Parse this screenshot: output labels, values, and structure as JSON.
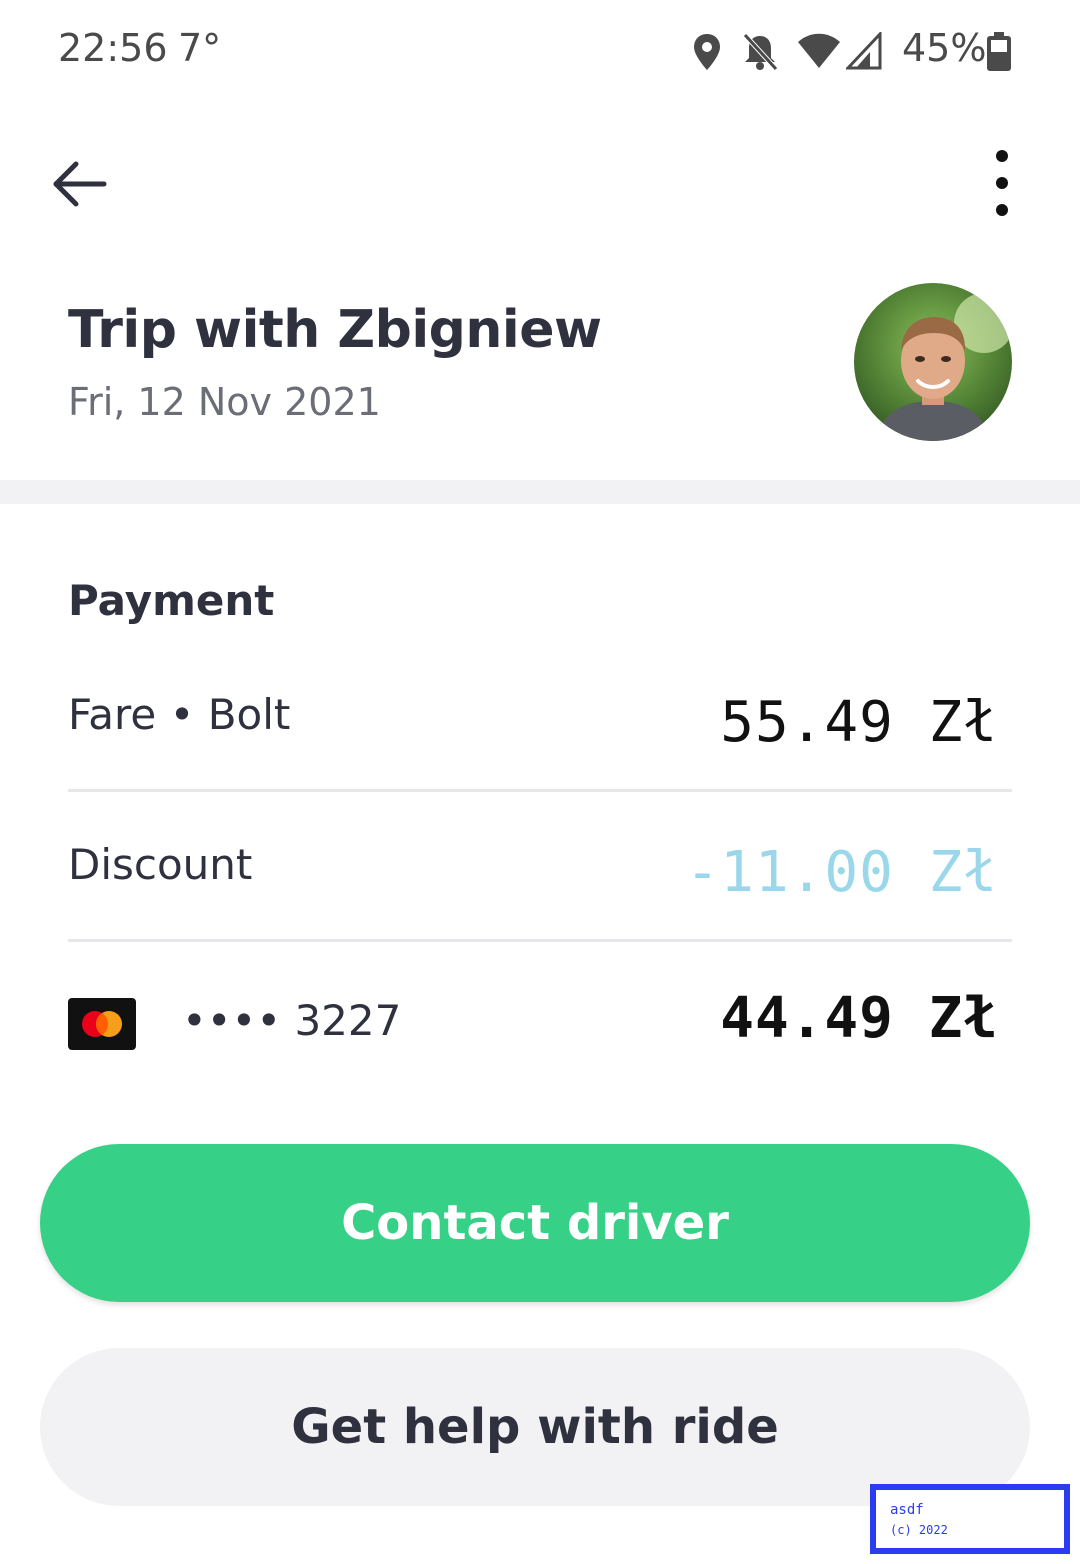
{
  "status_bar": {
    "time": "22:56",
    "temperature": "7°",
    "battery_percent": "45%",
    "icons": [
      "location-icon",
      "bell-off-icon",
      "wifi-icon",
      "signal-icon",
      "battery-icon"
    ]
  },
  "top_bar": {
    "back_icon": "arrow-left-icon",
    "menu_icon": "more-vertical-icon"
  },
  "header": {
    "title": "Trip with Zbigniew",
    "date": "Fri, 12 Nov 2021",
    "avatar": "driver-avatar"
  },
  "payment": {
    "heading": "Payment",
    "rows": [
      {
        "label": "Fare • Bolt",
        "amount": "55.49 Zł"
      },
      {
        "label": "Discount",
        "amount": "-11.00 Zł"
      },
      {
        "card_dots": "•••• 3227",
        "amount": "44.49 Zł",
        "card_icon": "mastercard-icon"
      }
    ]
  },
  "actions": {
    "contact_driver": "Contact driver",
    "get_help": "Get help with ride"
  },
  "watermark": {
    "line1": "asdf",
    "line2": "(c) 2022"
  },
  "colors": {
    "accent_green": "#36d087",
    "discount_blue": "#9ad7ea",
    "text_dark": "#2f313f",
    "text_muted": "#6b6d77"
  }
}
